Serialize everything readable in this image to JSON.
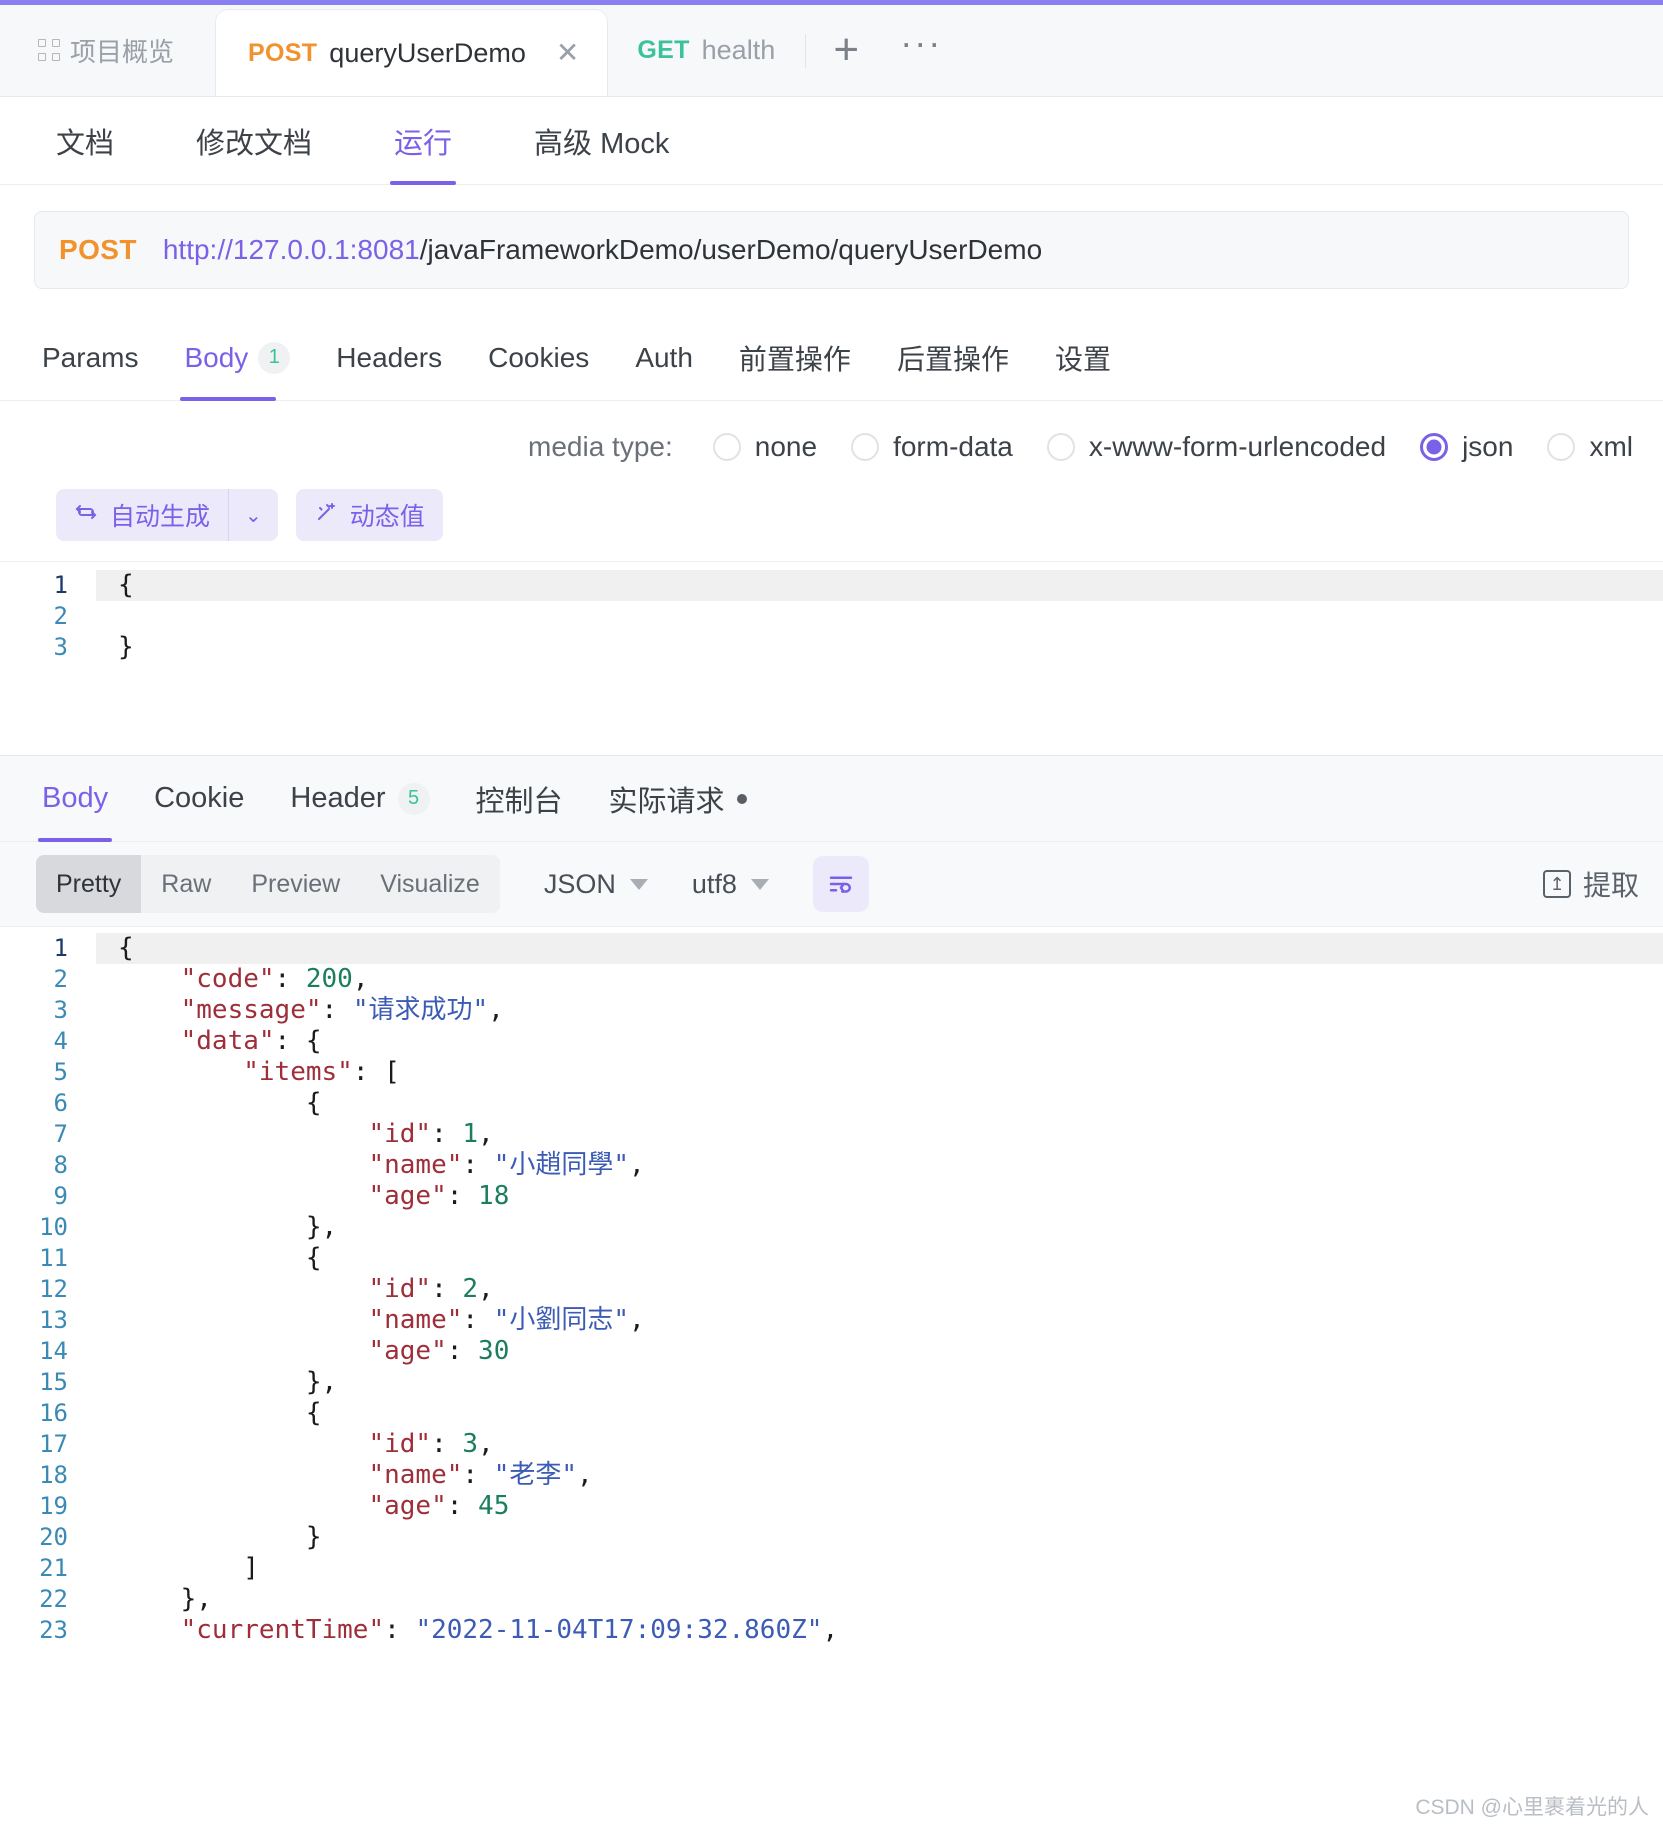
{
  "window": {
    "accent_color": "#8a7ff0"
  },
  "tabbar": {
    "project_tab": {
      "label": "项目概览",
      "icon": "grid-icon"
    },
    "tabs": [
      {
        "method": "POST",
        "name": "queryUserDemo",
        "active": true,
        "close_icon": "close-icon"
      },
      {
        "method": "GET",
        "name": "health",
        "active": false
      }
    ],
    "add_label": "+",
    "more_label": "···"
  },
  "subtabs": [
    {
      "label": "文档",
      "active": false
    },
    {
      "label": "修改文档",
      "active": false
    },
    {
      "label": "运行",
      "active": true
    },
    {
      "label": "高级 Mock",
      "active": false
    }
  ],
  "url": {
    "method": "POST",
    "host": "http://127.0.0.1:8081",
    "path": "/javaFrameworkDemo/userDemo/queryUserDemo"
  },
  "request_tabs": [
    {
      "label": "Params",
      "active": false,
      "badge": null
    },
    {
      "label": "Body",
      "active": true,
      "badge": "1"
    },
    {
      "label": "Headers",
      "active": false,
      "badge": null
    },
    {
      "label": "Cookies",
      "active": false,
      "badge": null
    },
    {
      "label": "Auth",
      "active": false,
      "badge": null
    },
    {
      "label": "前置操作",
      "active": false,
      "badge": null
    },
    {
      "label": "后置操作",
      "active": false,
      "badge": null
    },
    {
      "label": "设置",
      "active": false,
      "badge": null
    }
  ],
  "media_type": {
    "label": "media type:",
    "selected": "json",
    "options": [
      {
        "label": "none",
        "checked": false
      },
      {
        "label": "form-data",
        "checked": false
      },
      {
        "label": "x-www-form-urlencoded",
        "checked": false
      },
      {
        "label": "json",
        "checked": true
      },
      {
        "label": "xml",
        "checked": false
      }
    ]
  },
  "body_toolbar": {
    "auto_generate": {
      "label": "自动生成",
      "icon": "refresh-icon",
      "caret": "⌄"
    },
    "dynamic_value": {
      "label": "动态值",
      "icon": "sparkle-icon"
    }
  },
  "request_body": {
    "lines": [
      {
        "no": "1",
        "text": "{",
        "active": true
      },
      {
        "no": "2",
        "text": "",
        "active": false
      },
      {
        "no": "3",
        "text": "}",
        "active": false
      }
    ]
  },
  "response_tabs": [
    {
      "label": "Body",
      "active": true,
      "badge": null,
      "dot": false
    },
    {
      "label": "Cookie",
      "active": false,
      "badge": null,
      "dot": false
    },
    {
      "label": "Header",
      "active": false,
      "badge": "5",
      "dot": false
    },
    {
      "label": "控制台",
      "active": false,
      "badge": null,
      "dot": false
    },
    {
      "label": "实际请求",
      "active": false,
      "badge": null,
      "dot": true
    }
  ],
  "response_toolbar": {
    "segments": [
      {
        "label": "Pretty",
        "active": true
      },
      {
        "label": "Raw",
        "active": false
      },
      {
        "label": "Preview",
        "active": false
      },
      {
        "label": "Visualize",
        "active": false
      }
    ],
    "format": "JSON",
    "encoding": "utf8",
    "wrap_icon": "text-wrap-icon",
    "extract": {
      "label": "提取",
      "icon": "extract-icon"
    }
  },
  "response_body": {
    "lines": [
      {
        "no": "1",
        "active": true,
        "tokens": [
          {
            "t": "pun",
            "v": "{"
          }
        ]
      },
      {
        "no": "2",
        "active": false,
        "tokens": [
          {
            "t": "pun",
            "v": "    "
          },
          {
            "t": "key",
            "v": "\"code\""
          },
          {
            "t": "pun",
            "v": ": "
          },
          {
            "t": "num",
            "v": "200"
          },
          {
            "t": "pun",
            "v": ","
          }
        ]
      },
      {
        "no": "3",
        "active": false,
        "tokens": [
          {
            "t": "pun",
            "v": "    "
          },
          {
            "t": "key",
            "v": "\"message\""
          },
          {
            "t": "pun",
            "v": ": "
          },
          {
            "t": "str",
            "v": "\"请求成功\""
          },
          {
            "t": "pun",
            "v": ","
          }
        ]
      },
      {
        "no": "4",
        "active": false,
        "tokens": [
          {
            "t": "pun",
            "v": "    "
          },
          {
            "t": "key",
            "v": "\"data\""
          },
          {
            "t": "pun",
            "v": ": {"
          }
        ]
      },
      {
        "no": "5",
        "active": false,
        "tokens": [
          {
            "t": "pun",
            "v": "        "
          },
          {
            "t": "key",
            "v": "\"items\""
          },
          {
            "t": "pun",
            "v": ": ["
          }
        ]
      },
      {
        "no": "6",
        "active": false,
        "tokens": [
          {
            "t": "pun",
            "v": "            {"
          }
        ]
      },
      {
        "no": "7",
        "active": false,
        "tokens": [
          {
            "t": "pun",
            "v": "                "
          },
          {
            "t": "key",
            "v": "\"id\""
          },
          {
            "t": "pun",
            "v": ": "
          },
          {
            "t": "num",
            "v": "1"
          },
          {
            "t": "pun",
            "v": ","
          }
        ]
      },
      {
        "no": "8",
        "active": false,
        "tokens": [
          {
            "t": "pun",
            "v": "                "
          },
          {
            "t": "key",
            "v": "\"name\""
          },
          {
            "t": "pun",
            "v": ": "
          },
          {
            "t": "str",
            "v": "\"小趙同學\""
          },
          {
            "t": "pun",
            "v": ","
          }
        ]
      },
      {
        "no": "9",
        "active": false,
        "tokens": [
          {
            "t": "pun",
            "v": "                "
          },
          {
            "t": "key",
            "v": "\"age\""
          },
          {
            "t": "pun",
            "v": ": "
          },
          {
            "t": "num",
            "v": "18"
          }
        ]
      },
      {
        "no": "10",
        "active": false,
        "tokens": [
          {
            "t": "pun",
            "v": "            },"
          }
        ]
      },
      {
        "no": "11",
        "active": false,
        "tokens": [
          {
            "t": "pun",
            "v": "            {"
          }
        ]
      },
      {
        "no": "12",
        "active": false,
        "tokens": [
          {
            "t": "pun",
            "v": "                "
          },
          {
            "t": "key",
            "v": "\"id\""
          },
          {
            "t": "pun",
            "v": ": "
          },
          {
            "t": "num",
            "v": "2"
          },
          {
            "t": "pun",
            "v": ","
          }
        ]
      },
      {
        "no": "13",
        "active": false,
        "tokens": [
          {
            "t": "pun",
            "v": "                "
          },
          {
            "t": "key",
            "v": "\"name\""
          },
          {
            "t": "pun",
            "v": ": "
          },
          {
            "t": "str",
            "v": "\"小劉同志\""
          },
          {
            "t": "pun",
            "v": ","
          }
        ]
      },
      {
        "no": "14",
        "active": false,
        "tokens": [
          {
            "t": "pun",
            "v": "                "
          },
          {
            "t": "key",
            "v": "\"age\""
          },
          {
            "t": "pun",
            "v": ": "
          },
          {
            "t": "num",
            "v": "30"
          }
        ]
      },
      {
        "no": "15",
        "active": false,
        "tokens": [
          {
            "t": "pun",
            "v": "            },"
          }
        ]
      },
      {
        "no": "16",
        "active": false,
        "tokens": [
          {
            "t": "pun",
            "v": "            {"
          }
        ]
      },
      {
        "no": "17",
        "active": false,
        "tokens": [
          {
            "t": "pun",
            "v": "                "
          },
          {
            "t": "key",
            "v": "\"id\""
          },
          {
            "t": "pun",
            "v": ": "
          },
          {
            "t": "num",
            "v": "3"
          },
          {
            "t": "pun",
            "v": ","
          }
        ]
      },
      {
        "no": "18",
        "active": false,
        "tokens": [
          {
            "t": "pun",
            "v": "                "
          },
          {
            "t": "key",
            "v": "\"name\""
          },
          {
            "t": "pun",
            "v": ": "
          },
          {
            "t": "str",
            "v": "\"老李\""
          },
          {
            "t": "pun",
            "v": ","
          }
        ]
      },
      {
        "no": "19",
        "active": false,
        "tokens": [
          {
            "t": "pun",
            "v": "                "
          },
          {
            "t": "key",
            "v": "\"age\""
          },
          {
            "t": "pun",
            "v": ": "
          },
          {
            "t": "num",
            "v": "45"
          }
        ]
      },
      {
        "no": "20",
        "active": false,
        "tokens": [
          {
            "t": "pun",
            "v": "            }"
          }
        ]
      },
      {
        "no": "21",
        "active": false,
        "tokens": [
          {
            "t": "pun",
            "v": "        ]"
          }
        ]
      },
      {
        "no": "22",
        "active": false,
        "tokens": [
          {
            "t": "pun",
            "v": "    },"
          }
        ]
      },
      {
        "no": "23",
        "active": false,
        "tokens": [
          {
            "t": "pun",
            "v": "    "
          },
          {
            "t": "key",
            "v": "\"currentTime\""
          },
          {
            "t": "pun",
            "v": ": "
          },
          {
            "t": "str",
            "v": "\"2022-11-04T17:09:32.860Z\""
          },
          {
            "t": "pun",
            "v": ","
          }
        ]
      }
    ]
  },
  "watermark": "CSDN @心里裹着光的人"
}
